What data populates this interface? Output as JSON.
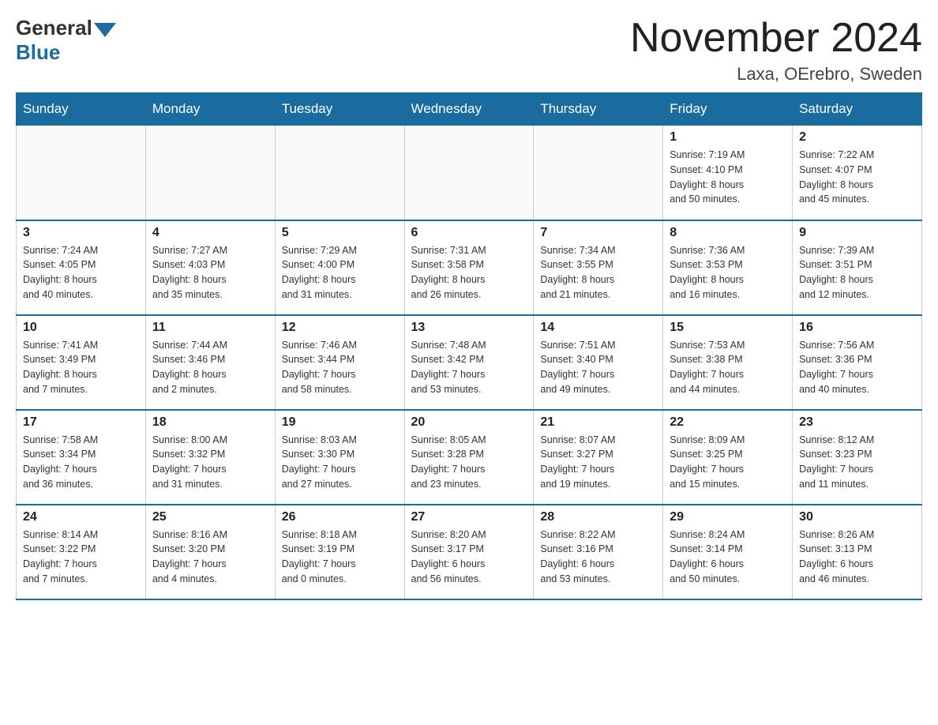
{
  "header": {
    "logo_general": "General",
    "logo_blue": "Blue",
    "month_title": "November 2024",
    "location": "Laxa, OErebro, Sweden"
  },
  "days_of_week": [
    "Sunday",
    "Monday",
    "Tuesday",
    "Wednesday",
    "Thursday",
    "Friday",
    "Saturday"
  ],
  "weeks": [
    [
      {
        "day": "",
        "info": ""
      },
      {
        "day": "",
        "info": ""
      },
      {
        "day": "",
        "info": ""
      },
      {
        "day": "",
        "info": ""
      },
      {
        "day": "",
        "info": ""
      },
      {
        "day": "1",
        "info": "Sunrise: 7:19 AM\nSunset: 4:10 PM\nDaylight: 8 hours\nand 50 minutes."
      },
      {
        "day": "2",
        "info": "Sunrise: 7:22 AM\nSunset: 4:07 PM\nDaylight: 8 hours\nand 45 minutes."
      }
    ],
    [
      {
        "day": "3",
        "info": "Sunrise: 7:24 AM\nSunset: 4:05 PM\nDaylight: 8 hours\nand 40 minutes."
      },
      {
        "day": "4",
        "info": "Sunrise: 7:27 AM\nSunset: 4:03 PM\nDaylight: 8 hours\nand 35 minutes."
      },
      {
        "day": "5",
        "info": "Sunrise: 7:29 AM\nSunset: 4:00 PM\nDaylight: 8 hours\nand 31 minutes."
      },
      {
        "day": "6",
        "info": "Sunrise: 7:31 AM\nSunset: 3:58 PM\nDaylight: 8 hours\nand 26 minutes."
      },
      {
        "day": "7",
        "info": "Sunrise: 7:34 AM\nSunset: 3:55 PM\nDaylight: 8 hours\nand 21 minutes."
      },
      {
        "day": "8",
        "info": "Sunrise: 7:36 AM\nSunset: 3:53 PM\nDaylight: 8 hours\nand 16 minutes."
      },
      {
        "day": "9",
        "info": "Sunrise: 7:39 AM\nSunset: 3:51 PM\nDaylight: 8 hours\nand 12 minutes."
      }
    ],
    [
      {
        "day": "10",
        "info": "Sunrise: 7:41 AM\nSunset: 3:49 PM\nDaylight: 8 hours\nand 7 minutes."
      },
      {
        "day": "11",
        "info": "Sunrise: 7:44 AM\nSunset: 3:46 PM\nDaylight: 8 hours\nand 2 minutes."
      },
      {
        "day": "12",
        "info": "Sunrise: 7:46 AM\nSunset: 3:44 PM\nDaylight: 7 hours\nand 58 minutes."
      },
      {
        "day": "13",
        "info": "Sunrise: 7:48 AM\nSunset: 3:42 PM\nDaylight: 7 hours\nand 53 minutes."
      },
      {
        "day": "14",
        "info": "Sunrise: 7:51 AM\nSunset: 3:40 PM\nDaylight: 7 hours\nand 49 minutes."
      },
      {
        "day": "15",
        "info": "Sunrise: 7:53 AM\nSunset: 3:38 PM\nDaylight: 7 hours\nand 44 minutes."
      },
      {
        "day": "16",
        "info": "Sunrise: 7:56 AM\nSunset: 3:36 PM\nDaylight: 7 hours\nand 40 minutes."
      }
    ],
    [
      {
        "day": "17",
        "info": "Sunrise: 7:58 AM\nSunset: 3:34 PM\nDaylight: 7 hours\nand 36 minutes."
      },
      {
        "day": "18",
        "info": "Sunrise: 8:00 AM\nSunset: 3:32 PM\nDaylight: 7 hours\nand 31 minutes."
      },
      {
        "day": "19",
        "info": "Sunrise: 8:03 AM\nSunset: 3:30 PM\nDaylight: 7 hours\nand 27 minutes."
      },
      {
        "day": "20",
        "info": "Sunrise: 8:05 AM\nSunset: 3:28 PM\nDaylight: 7 hours\nand 23 minutes."
      },
      {
        "day": "21",
        "info": "Sunrise: 8:07 AM\nSunset: 3:27 PM\nDaylight: 7 hours\nand 19 minutes."
      },
      {
        "day": "22",
        "info": "Sunrise: 8:09 AM\nSunset: 3:25 PM\nDaylight: 7 hours\nand 15 minutes."
      },
      {
        "day": "23",
        "info": "Sunrise: 8:12 AM\nSunset: 3:23 PM\nDaylight: 7 hours\nand 11 minutes."
      }
    ],
    [
      {
        "day": "24",
        "info": "Sunrise: 8:14 AM\nSunset: 3:22 PM\nDaylight: 7 hours\nand 7 minutes."
      },
      {
        "day": "25",
        "info": "Sunrise: 8:16 AM\nSunset: 3:20 PM\nDaylight: 7 hours\nand 4 minutes."
      },
      {
        "day": "26",
        "info": "Sunrise: 8:18 AM\nSunset: 3:19 PM\nDaylight: 7 hours\nand 0 minutes."
      },
      {
        "day": "27",
        "info": "Sunrise: 8:20 AM\nSunset: 3:17 PM\nDaylight: 6 hours\nand 56 minutes."
      },
      {
        "day": "28",
        "info": "Sunrise: 8:22 AM\nSunset: 3:16 PM\nDaylight: 6 hours\nand 53 minutes."
      },
      {
        "day": "29",
        "info": "Sunrise: 8:24 AM\nSunset: 3:14 PM\nDaylight: 6 hours\nand 50 minutes."
      },
      {
        "day": "30",
        "info": "Sunrise: 8:26 AM\nSunset: 3:13 PM\nDaylight: 6 hours\nand 46 minutes."
      }
    ]
  ]
}
